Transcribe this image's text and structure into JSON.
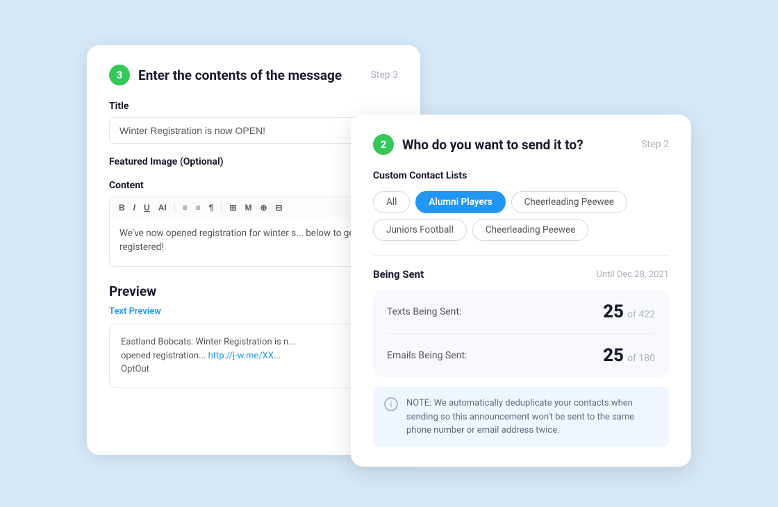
{
  "step3": {
    "badge": "3",
    "title": "Enter the contents of the message",
    "step_label": "Step 3",
    "title_field_label": "Title",
    "title_field_value": "Winter Registration is now OPEN!",
    "title_field_placeholder": "Winter Registration is now OPEN!",
    "featured_image_label": "Featured Image (Optional)",
    "content_label": "Content",
    "toolbar_buttons": [
      "B",
      "I",
      "U",
      "AI",
      "≡",
      "≡",
      "¶",
      "⊞",
      "M",
      "⊕",
      "⊟"
    ],
    "content_text": "We've now opened registration for winter s...\nbelow to get registered!",
    "preview_title": "Preview",
    "text_preview_label": "Text Preview",
    "preview_content": "Eastland Bobcats: Winter Registration is n...\nopened registration... http://j-w.me/XX...\nOptOut"
  },
  "step2": {
    "badge": "2",
    "title": "Who do you want to send it to?",
    "step_label": "Step 2",
    "custom_contact_lists_label": "Custom Contact Lists",
    "tags": [
      {
        "label": "All",
        "active": false
      },
      {
        "label": "Alumni Players",
        "active": true
      },
      {
        "label": "Cheerleading Peewee",
        "active": false
      },
      {
        "label": "Juniors Football",
        "active": false
      },
      {
        "label": "Cheerleading Peewee",
        "active": false
      }
    ],
    "being_sent_label": "Being Sent",
    "being_sent_date": "Until Dec 28, 2021",
    "texts_label": "Texts Being Sent:",
    "texts_count": "25",
    "texts_of": "of 422",
    "emails_label": "Emails  Being Sent:",
    "emails_count": "25",
    "emails_of": "of 180",
    "note_text": "NOTE: We automatically deduplicate your contacts when sending so this announcement won't be sent to the same phone number or email address twice."
  }
}
